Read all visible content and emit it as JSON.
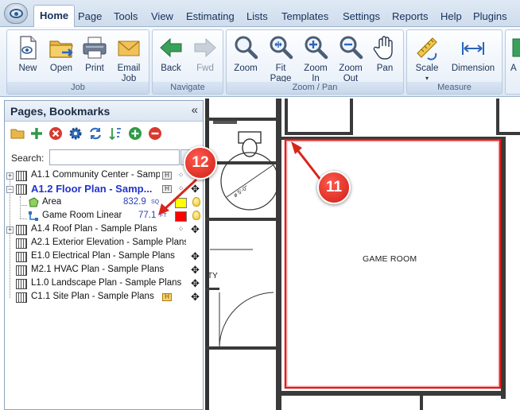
{
  "menu": {
    "tabs": [
      "Home",
      "Page",
      "Tools",
      "View",
      "Estimating",
      "Lists",
      "Templates",
      "Settings",
      "Reports",
      "Help",
      "Plugins"
    ],
    "active": "Home"
  },
  "ribbon": {
    "groups": {
      "job": "Job",
      "navigate": "Navigate",
      "zoom_pan": "Zoom / Pan",
      "measure": "Measure"
    },
    "buttons": {
      "new": "New",
      "open": "Open",
      "print": "Print",
      "email_job": "Email\nJob",
      "back": "Back",
      "fwd": "Fwd",
      "zoom": "Zoom",
      "fit_page": "Fit\nPage",
      "zoom_in": "Zoom\nIn",
      "zoom_out": "Zoom\nOut",
      "pan": "Pan",
      "scale": "Scale",
      "dimension": "Dimension",
      "cut_off": "A"
    }
  },
  "panel": {
    "title": "Pages, Bookmarks",
    "collapse": "«",
    "search_label": "Search:",
    "search_value": "",
    "rows": [
      {
        "label": "A1.1 Community Center - Samp..."
      },
      {
        "label": "A1.2 Floor Plan - Samp..."
      },
      {
        "label": "Area",
        "value": "832.9",
        "unit": "SQ FT"
      },
      {
        "label": "Game Room Linear",
        "value": "77.1",
        "unit": "FT"
      },
      {
        "label": "A1.4 Roof Plan - Sample Plans"
      },
      {
        "label": "A2.1 Exterior Elevation - Sample Plans"
      },
      {
        "label": "E1.0 Electrical Plan - Sample Plans"
      },
      {
        "label": "M2.1 HVAC Plan - Sample Plans"
      },
      {
        "label": "L1.0 Landscape Plan - Sample Plans"
      },
      {
        "label": "C1.1 Site Plan - Sample Plans"
      }
    ]
  },
  "drawing": {
    "room_label": "GAME ROOM",
    "dimension_label": "ø 5'-0\"",
    "partial_text": "TY"
  },
  "callouts": {
    "c11": "11",
    "c12": "12"
  },
  "colors": {
    "area_swatch": "#ffff00",
    "linear_swatch": "#ff0000",
    "room_outline": "#e41b1b",
    "callout": "#d8261b"
  }
}
